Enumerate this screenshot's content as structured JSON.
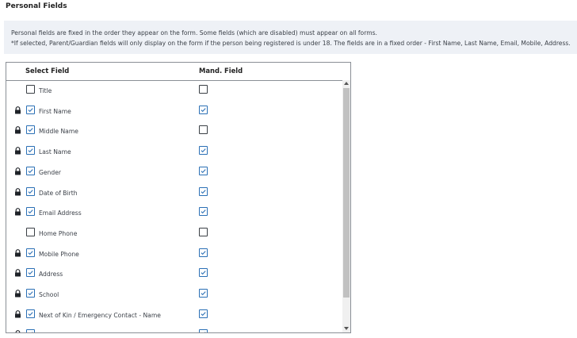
{
  "section": {
    "title": "Personal Fields",
    "info_line1": "Personal fields are fixed in the order they appear on the form. Some fields (which are disabled) must appear on all forms.",
    "info_line2": "*If selected, Parent/Guardian fields will only display on the form if the person being registered is under 18. The fields are in a fixed order - First Name, Last Name, Email, Mobile, Address."
  },
  "table": {
    "col_select": "Select Field",
    "col_mand": "Mand. Field",
    "rows": [
      {
        "label": "Title",
        "locked": false,
        "selected": false,
        "mandatory": false
      },
      {
        "label": "First Name",
        "locked": true,
        "selected": true,
        "mandatory": true
      },
      {
        "label": "Middle Name",
        "locked": true,
        "selected": true,
        "mandatory": false
      },
      {
        "label": "Last Name",
        "locked": true,
        "selected": true,
        "mandatory": true
      },
      {
        "label": "Gender",
        "locked": true,
        "selected": true,
        "mandatory": true
      },
      {
        "label": "Date of Birth",
        "locked": true,
        "selected": true,
        "mandatory": true
      },
      {
        "label": "Email Address",
        "locked": true,
        "selected": true,
        "mandatory": true
      },
      {
        "label": "Home Phone",
        "locked": false,
        "selected": false,
        "mandatory": false
      },
      {
        "label": "Mobile Phone",
        "locked": true,
        "selected": true,
        "mandatory": true
      },
      {
        "label": "Address",
        "locked": true,
        "selected": true,
        "mandatory": true
      },
      {
        "label": "School",
        "locked": true,
        "selected": true,
        "mandatory": true
      },
      {
        "label": "Next of Kin / Emergency Contact - Name",
        "locked": true,
        "selected": true,
        "mandatory": true
      },
      {
        "label": "",
        "locked": true,
        "selected": true,
        "mandatory": true
      }
    ]
  },
  "colors": {
    "check_blue": "#2a6fb5",
    "info_bg": "#eef1f6"
  },
  "icons": {
    "lock": "lock-icon",
    "check": "checkmark-icon"
  }
}
